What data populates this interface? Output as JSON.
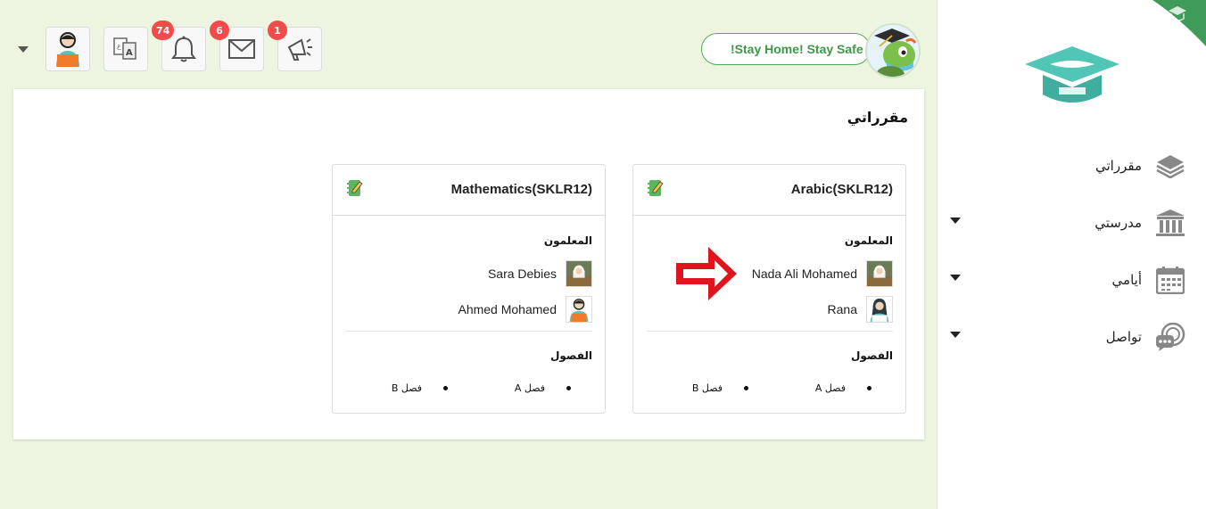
{
  "sidebar": {
    "items": [
      {
        "label": "مقرراتي",
        "icon": "layers-icon",
        "has_dropdown": false
      },
      {
        "label": "مدرستي",
        "icon": "school-building-icon",
        "has_dropdown": true
      },
      {
        "label": "أيامي",
        "icon": "calendar-icon",
        "has_dropdown": true
      },
      {
        "label": "تواصل",
        "icon": "chat-bubbles-icon",
        "has_dropdown": true
      }
    ]
  },
  "topbar": {
    "banner": "!Stay Home! Stay Safe",
    "buttons": [
      {
        "icon": "megaphone-icon",
        "badge": "1"
      },
      {
        "icon": "envelope-icon",
        "badge": "6"
      },
      {
        "icon": "bell-icon",
        "badge": "74"
      },
      {
        "icon": "translate-icon",
        "badge": ""
      },
      {
        "icon": "user-avatar-icon",
        "badge": ""
      }
    ]
  },
  "main": {
    "title": "مقرراتي",
    "courses": [
      {
        "title": "Arabic(SKLR12)",
        "teachers_label": "المعلمون",
        "teachers": [
          {
            "name": "Nada Ali Mohamed",
            "avatar": "female-teacher-photo"
          },
          {
            "name": "Rana",
            "avatar": "female-hijab-avatar"
          }
        ],
        "classes_label": "الفصول",
        "classes": [
          "فصل A",
          "فصل B"
        ]
      },
      {
        "title": "Mathematics(SKLR12)",
        "teachers_label": "المعلمون",
        "teachers": [
          {
            "name": "Sara Debies",
            "avatar": "female-teacher-photo"
          },
          {
            "name": "Ahmed Mohamed",
            "avatar": "male-avatar"
          }
        ],
        "classes_label": "الفصول",
        "classes": [
          "فصل A",
          "فصل B"
        ]
      }
    ]
  },
  "colors": {
    "page_bg": "#edf5e1",
    "accent_green": "#4caf50",
    "badge_red": "#f14b4b",
    "arrow_red": "#e0141e",
    "logo_teal": "#4fc3b2"
  }
}
